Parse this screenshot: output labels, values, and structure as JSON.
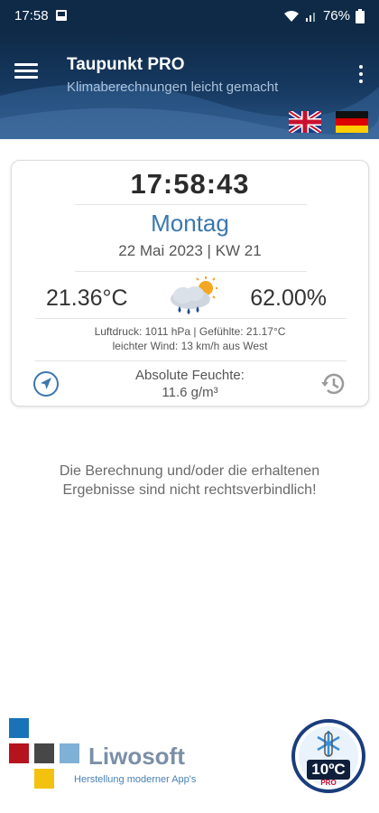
{
  "statusbar": {
    "time": "17:58",
    "battery": "76%",
    "icons": [
      "image-notification-icon",
      "wifi-icon",
      "signal-icon",
      "battery-icon"
    ]
  },
  "header": {
    "title": "Taupunkt PRO",
    "subtitle": "Klimaberechnungen leicht gemacht",
    "icons": [
      "hamburger-menu-icon",
      "more-vert-icon",
      "uk-flag-icon",
      "german-flag-icon"
    ]
  },
  "card": {
    "time": "17:58:43",
    "weekday": "Montag",
    "date": "22 Mai 2023 | KW 21",
    "temperature": "21.36°C",
    "humidity": "62.00%",
    "weather_icon": "cloud-rain-sun-icon",
    "info_line1": "Luftdruck: 1011 hPa | Gefühlte: 21.17°C",
    "info_line2": "leichter Wind: 13 km/h aus West",
    "absolute_label": "Absolute Feuchte:",
    "absolute_value": "11.6 g/m³",
    "left_icon": "navigation-arrow-icon",
    "right_icon": "history-icon"
  },
  "disclaimer": {
    "line1": "Die Berechnung und/oder die erhaltenen",
    "line2": "Ergebnisse sind nicht rechtsverbindlich!"
  },
  "footer": {
    "brand": "Liwosoft",
    "brand_sub": "Herstellung moderner App's",
    "badge_text": "10ºC",
    "badge_sub": "PRO"
  },
  "colors": {
    "header_dark": "#0e2a47",
    "accent_blue": "#3b78ad",
    "text_dark": "#2b2b2b"
  }
}
